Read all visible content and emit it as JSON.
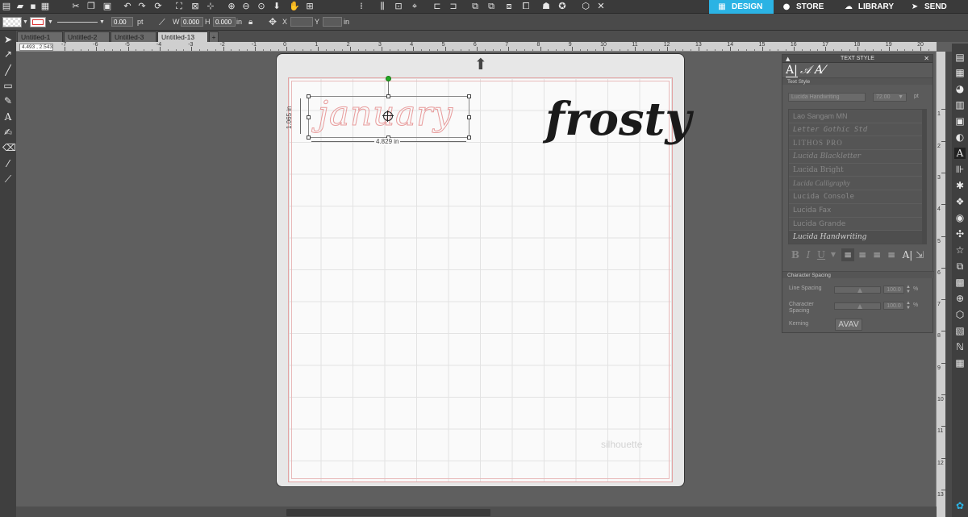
{
  "nav_tabs": [
    {
      "label": "DESIGN",
      "icon": "grid-icon",
      "active": true
    },
    {
      "label": "STORE",
      "icon": "silhouette-s-icon",
      "active": false
    },
    {
      "label": "LIBRARY",
      "icon": "cloud-icon",
      "active": false
    },
    {
      "label": "SEND",
      "icon": "send-icon",
      "active": false
    }
  ],
  "toolbar": {
    "line_width": "0.00",
    "line_unit": "pt",
    "w_label": "W",
    "w_value": "0.000",
    "h_label": "H",
    "h_value": "0.000",
    "size_unit": "in",
    "x_label": "X",
    "y_label": "Y",
    "pos_unit": "in"
  },
  "doc_tabs": [
    {
      "label": "Untitled-1",
      "active": false
    },
    {
      "label": "Untitled-2",
      "active": false
    },
    {
      "label": "Untitled-3",
      "active": false
    },
    {
      "label": "Untitled-13",
      "active": true
    },
    {
      "label": "+",
      "active": false
    }
  ],
  "coord_readout": "4.493 , 2.543",
  "ruler_h": [
    "-7",
    "-6",
    "-5",
    "-4",
    "-3",
    "-2",
    "-1",
    "0",
    "1",
    "2",
    "3",
    "4",
    "5",
    "6",
    "7",
    "8",
    "9",
    "10",
    "11",
    "12",
    "13",
    "14",
    "15",
    "16",
    "17",
    "18",
    "19",
    "20"
  ],
  "ruler_v": [
    "1",
    "2",
    "3",
    "4",
    "5",
    "6",
    "7",
    "8",
    "9",
    "10",
    "11",
    "12",
    "13"
  ],
  "canvas": {
    "text_outline": "january",
    "text_solid": "frosty",
    "height_label": "1.065 in",
    "width_label": "4.829 in",
    "watermark": "silhouette"
  },
  "text_style_panel": {
    "title": "TEXT STYLE",
    "section_text_style": "Text Style",
    "font_value": "Lucida Handwriting",
    "size_value": "72.00",
    "size_unit": "pt",
    "fonts": [
      "Lao Sangam MN",
      "Letter Gothic Std",
      "LITHOS PRO",
      "Lucida Blackletter",
      "Lucida Bright",
      "Lucida Calligraphy",
      "Lucida Console",
      "Lucida Fax",
      "Lucida Grande",
      "Lucida Handwriting"
    ],
    "selected_font": "Lucida Handwriting",
    "section_char_spacing": "Character Spacing",
    "line_spacing_label": "Line Spacing",
    "line_spacing_value": "100.0",
    "char_spacing_label": "Character Spacing",
    "char_spacing_value": "100.0",
    "percent": "%",
    "kerning_label": "Kerning",
    "kerning_button": "AVAV"
  },
  "colors": {
    "accent": "#2bb3e4",
    "cut_line": "#e3a3a3",
    "selected_handle": "#22aa22"
  }
}
